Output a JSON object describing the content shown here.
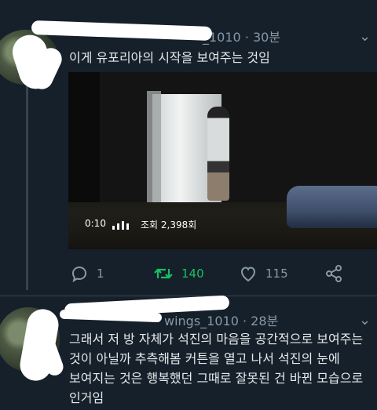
{
  "tweets": [
    {
      "handle_suffix": "_1010",
      "time": "· 30분",
      "text": "이게 유포리아의 시작을 보여주는 것임",
      "video": {
        "time": "0:10",
        "views": "조회 2,398회"
      },
      "actions": {
        "replies": "1",
        "retweets": "140",
        "likes": "115"
      }
    },
    {
      "handle_suffix": "wings_1010",
      "time": "· 28분",
      "text_lines": [
        "그래서 저 방 자체가 석진의 마음을 공간적으로 보여주는",
        "것이 아닐까 추측해봄 커튼을 열고 나서 석진의 눈에",
        "보여지는 것은 행복했던 그때로 잘못된 건 바뀐 모습으로",
        "인거임"
      ]
    }
  ],
  "colors": {
    "background": "#15202b",
    "text": "#e6e9ea",
    "muted": "#8899a6",
    "retweet": "#17bf63",
    "divider": "#38444d"
  },
  "icons": {
    "reply": "reply-icon",
    "retweet": "retweet-icon",
    "like": "heart-icon",
    "share": "share-icon",
    "more": "chevron-down-icon"
  }
}
